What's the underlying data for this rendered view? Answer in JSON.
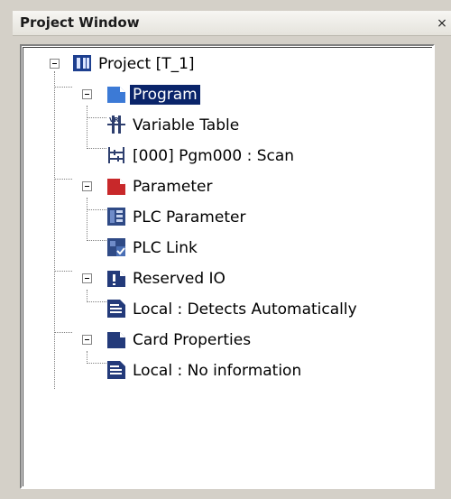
{
  "window": {
    "title": "Project Window",
    "close_glyph": "×"
  },
  "tree": {
    "root": {
      "label": "Project [T_1]",
      "icon": "project-icon"
    },
    "program": {
      "label": "Program",
      "icon": "program-folder-icon",
      "selected": true,
      "children": [
        {
          "label": "Variable Table",
          "icon": "variable-table-icon"
        },
        {
          "label": "[000] Pgm000 : Scan",
          "icon": "ladder-program-icon"
        }
      ]
    },
    "parameter": {
      "label": "Parameter",
      "icon": "parameter-folder-icon",
      "children": [
        {
          "label": "PLC Parameter",
          "icon": "plc-parameter-icon"
        },
        {
          "label": "PLC Link",
          "icon": "plc-link-icon"
        }
      ]
    },
    "reserved_io": {
      "label": "Reserved IO",
      "icon": "reserved-io-icon",
      "children": [
        {
          "label": "Local : Detects Automatically",
          "icon": "io-module-icon"
        }
      ]
    },
    "card_properties": {
      "label": "Card Properties",
      "icon": "card-properties-icon",
      "children": [
        {
          "label": "Local : No information",
          "icon": "io-module-icon"
        }
      ]
    }
  },
  "colors": {
    "selection_bg": "#0a246a",
    "program_icon": "#3c7ad6",
    "parameter_icon": "#c8282a",
    "io_icon": "#233a7a"
  }
}
